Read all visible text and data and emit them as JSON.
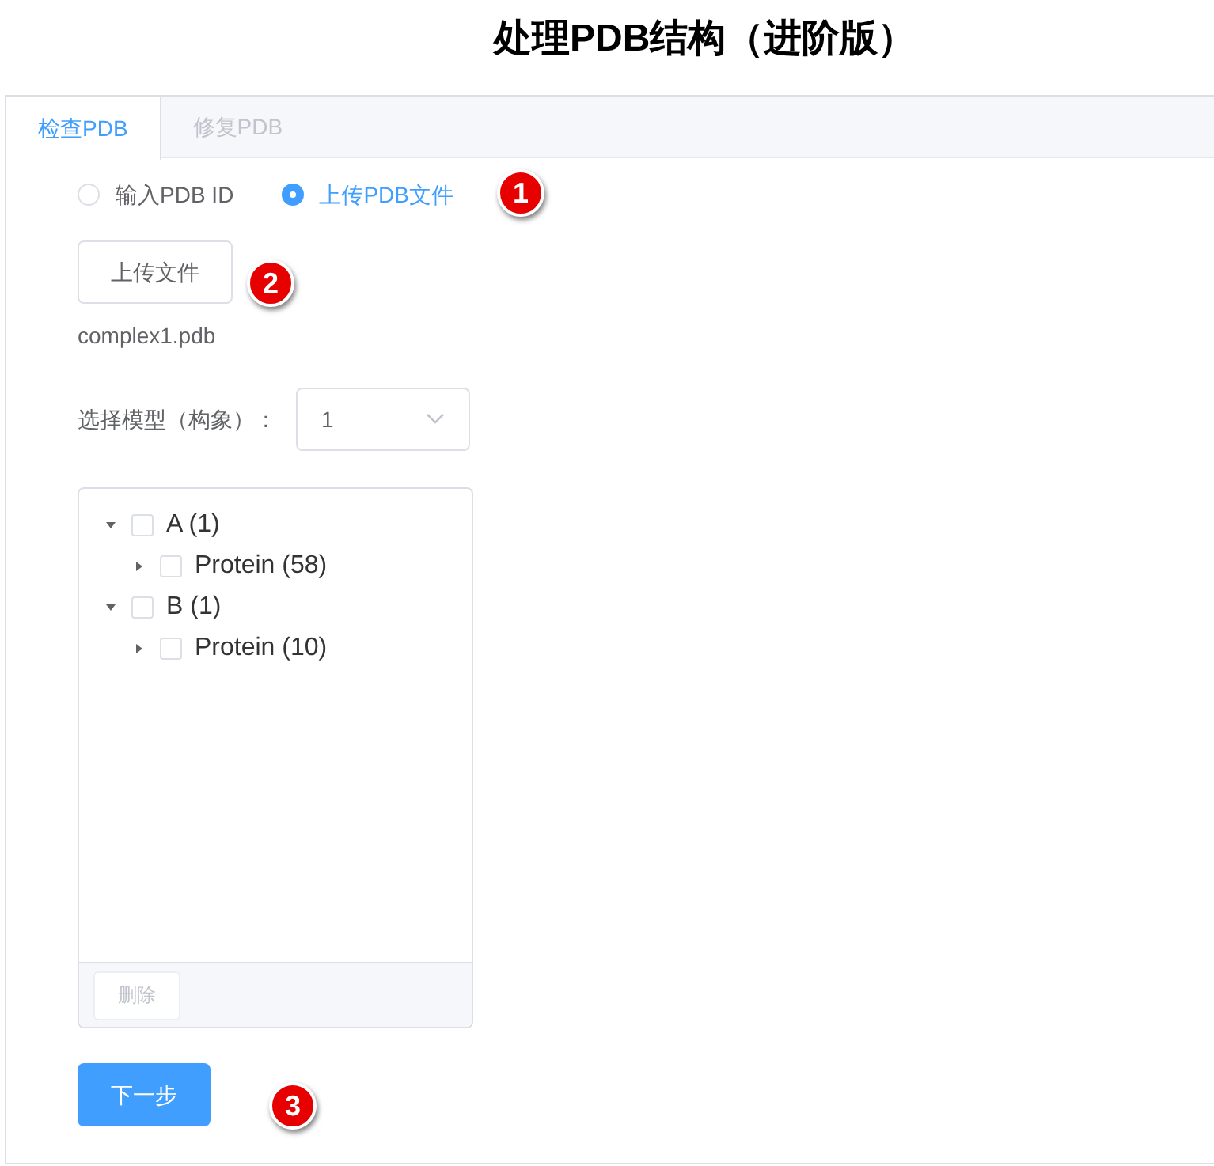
{
  "title": "处理PDB结构（进阶版）",
  "tabs": [
    {
      "label": "检查PDB",
      "selected": true
    },
    {
      "label": "修复PDB",
      "selected": false
    }
  ],
  "source_options": [
    {
      "label": "输入PDB ID",
      "selected": false
    },
    {
      "label": "上传PDB文件",
      "selected": true
    }
  ],
  "upload_button": "上传文件",
  "file_name": "complex1.pdb",
  "model_select": {
    "label": "选择模型（构象）：",
    "value": "1"
  },
  "tree": [
    {
      "label": "A (1)",
      "expanded": true,
      "checked": false,
      "children": [
        {
          "label": "Protein (58)",
          "expanded": false,
          "checked": false
        }
      ]
    },
    {
      "label": "B (1)",
      "expanded": true,
      "checked": false,
      "children": [
        {
          "label": "Protein (10)",
          "expanded": false,
          "checked": false
        }
      ]
    }
  ],
  "delete_button": {
    "label": "删除",
    "disabled": true
  },
  "next_button": "下一步",
  "callouts": [
    "1",
    "2",
    "3"
  ]
}
